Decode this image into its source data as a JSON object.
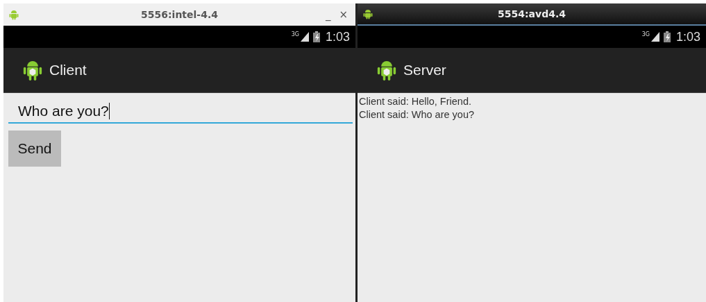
{
  "windows": [
    {
      "title": "5556:intel-4.4",
      "active": false,
      "controls": [
        "_",
        "×"
      ],
      "status_bar": {
        "network": "3G",
        "time": "1:03"
      },
      "app_title": "Client",
      "content": {
        "kind": "form",
        "field": {
          "value": "Who are you?",
          "focused": true
        },
        "button": "Send"
      }
    },
    {
      "title": "5554:avd4.4",
      "active": true,
      "status_bar": {
        "network": "3G",
        "time": "1:03"
      },
      "app_title": "Server",
      "content": {
        "kind": "log",
        "lines": [
          "Client said: Hello, Friend.",
          "Client said: Who are you?"
        ]
      }
    }
  ]
}
